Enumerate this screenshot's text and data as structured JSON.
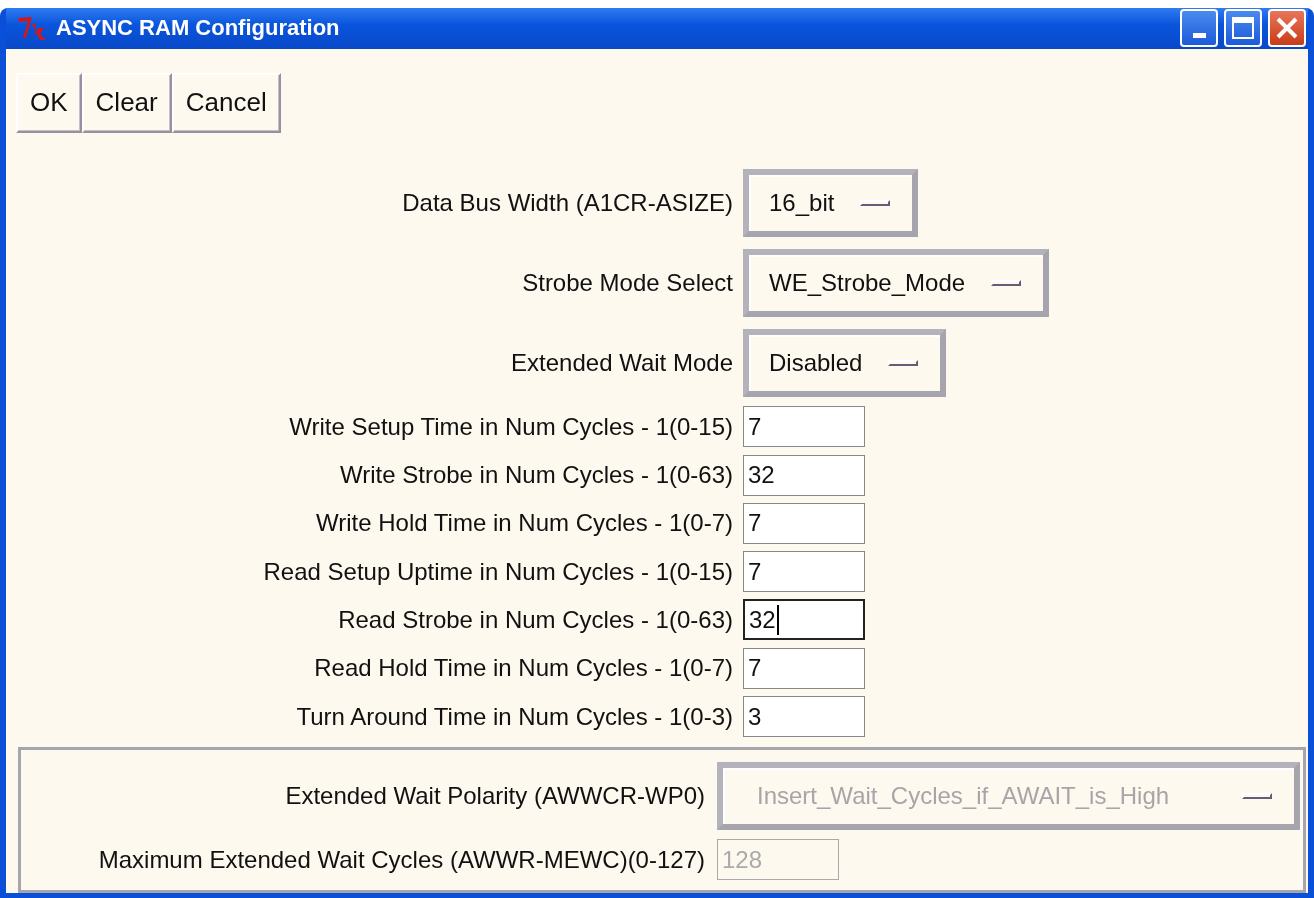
{
  "window": {
    "title": "ASYNC RAM Configuration"
  },
  "buttons": [
    "OK",
    "Clear",
    "Cancel"
  ],
  "fields": [
    {
      "kind": "dropdown",
      "label": "Data Bus Width (A1CR-ASIZE)",
      "value": "16_bit"
    },
    {
      "kind": "dropdown",
      "label": "Strobe Mode Select",
      "value": "WE_Strobe_Mode"
    },
    {
      "kind": "dropdown",
      "label": "Extended Wait Mode",
      "value": "Disabled"
    },
    {
      "kind": "entry",
      "label": "Write Setup Time in Num Cycles - 1(0-15)",
      "value": "7",
      "focused": false
    },
    {
      "kind": "entry",
      "label": "Write Strobe in Num Cycles - 1(0-63)",
      "value": "32",
      "focused": false
    },
    {
      "kind": "entry",
      "label": "Write Hold Time in Num Cycles - 1(0-7)",
      "value": "7",
      "focused": false
    },
    {
      "kind": "entry",
      "label": "Read Setup Uptime in Num Cycles - 1(0-15)",
      "value": "7",
      "focused": false
    },
    {
      "kind": "entry",
      "label": "Read Strobe in Num Cycles - 1(0-63)",
      "value": "32",
      "focused": true
    },
    {
      "kind": "entry",
      "label": "Read Hold Time in Num Cycles - 1(0-7)",
      "value": "7",
      "focused": false
    },
    {
      "kind": "entry",
      "label": "Turn Around Time in Num Cycles - 1(0-3)",
      "value": "3",
      "focused": false
    }
  ],
  "wait_group": [
    {
      "kind": "dropdown",
      "label": "Extended Wait Polarity (AWWCR-WP0)",
      "value": "Insert_Wait_Cycles_if_AWAIT_is_High",
      "disabled": true
    },
    {
      "kind": "entry",
      "label": "Maximum Extended Wait Cycles (AWWR-MEWC)(0-127)",
      "value": "128",
      "disabled": true
    }
  ]
}
